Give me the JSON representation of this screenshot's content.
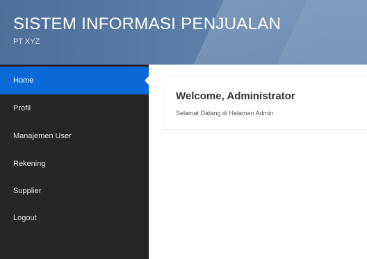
{
  "header": {
    "title": "SISTEM INFORMASI PENJUALAN",
    "subtitle": "PT XYZ"
  },
  "sidebar": {
    "items": [
      {
        "label": "Home",
        "active": true
      },
      {
        "label": "Profil",
        "active": false
      },
      {
        "label": "Manajemen User",
        "active": false
      },
      {
        "label": "Rekening",
        "active": false
      },
      {
        "label": "Supplier",
        "active": false
      },
      {
        "label": "Logout",
        "active": false
      }
    ]
  },
  "main": {
    "welcome_title": "Welcome, Administrator",
    "welcome_text": "Selamat Datang di Halaman Admin"
  },
  "colors": {
    "header": "#5c7ea8",
    "sidebar": "#262626",
    "active": "#0a69d6"
  }
}
